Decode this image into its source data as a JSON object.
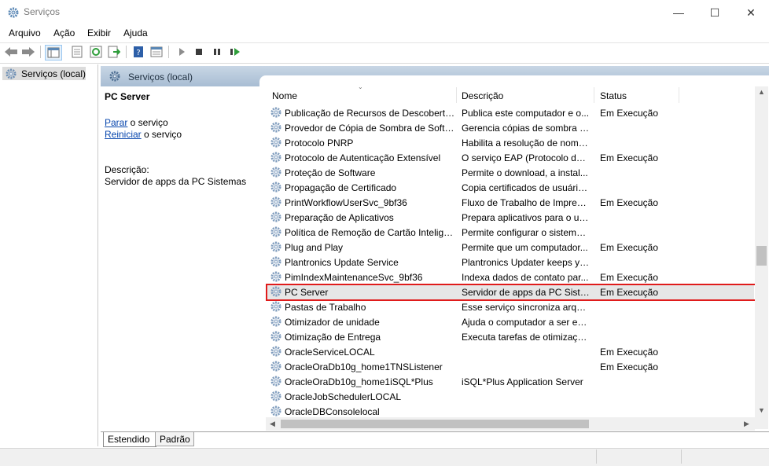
{
  "window": {
    "title": "Serviços",
    "controls": {
      "minimize": "—",
      "maximize": "☐",
      "close": "✕"
    }
  },
  "menu": [
    "Arquivo",
    "Ação",
    "Exibir",
    "Ajuda"
  ],
  "tree": {
    "root_label": "Serviços (local)"
  },
  "pane": {
    "header_title": "Serviços (local)",
    "selected_service_title": "PC Server",
    "links": {
      "stop": "Parar",
      "stop_suffix": " o serviço",
      "restart": "Reiniciar",
      "restart_suffix": " o serviço"
    },
    "description_label": "Descrição:",
    "description_text": "Servidor de apps da PC Sistemas"
  },
  "table": {
    "columns": [
      "Nome",
      "Descrição",
      "Status"
    ],
    "rows": [
      {
        "name": "Publicação de Recursos de Descoberta ...",
        "desc": "Publica este computador e o...",
        "status": "Em Execução"
      },
      {
        "name": "Provedor de Cópia de Sombra de Softw...",
        "desc": "Gerencia cópias de sombra d...",
        "status": ""
      },
      {
        "name": "Protocolo PNRP",
        "desc": "Habilita a resolução de nome...",
        "status": ""
      },
      {
        "name": "Protocolo de Autenticação Extensível",
        "desc": "O serviço EAP (Protocolo de ...",
        "status": "Em Execução"
      },
      {
        "name": "Proteção de Software",
        "desc": "Permite o download, a instal...",
        "status": ""
      },
      {
        "name": "Propagação de Certificado",
        "desc": "Copia certificados de usuário...",
        "status": ""
      },
      {
        "name": "PrintWorkflowUserSvc_9bf36",
        "desc": "Fluxo de Trabalho de Impress...",
        "status": "Em Execução"
      },
      {
        "name": "Preparação de Aplicativos",
        "desc": "Prepara aplicativos para o us...",
        "status": ""
      },
      {
        "name": "Política de Remoção de Cartão Intelige...",
        "desc": "Permite configurar o sistema ...",
        "status": ""
      },
      {
        "name": "Plug and Play",
        "desc": "Permite que um computador...",
        "status": "Em Execução"
      },
      {
        "name": "Plantronics Update Service",
        "desc": "Plantronics Updater keeps yo...",
        "status": ""
      },
      {
        "name": "PimIndexMaintenanceSvc_9bf36",
        "desc": "Indexa dados de contato par...",
        "status": "Em Execução"
      },
      {
        "name": "PC Server",
        "desc": "Servidor de apps da PC Siste...",
        "status": "Em Execução",
        "selected": true
      },
      {
        "name": "Pastas de Trabalho",
        "desc": "Esse serviço sincroniza arquiv...",
        "status": ""
      },
      {
        "name": "Otimizador de unidade",
        "desc": "Ajuda o computador a ser ex...",
        "status": ""
      },
      {
        "name": "Otimização de Entrega",
        "desc": "Executa tarefas de otimizaçã...",
        "status": ""
      },
      {
        "name": "OracleServiceLOCAL",
        "desc": "",
        "status": "Em Execução"
      },
      {
        "name": "OracleOraDb10g_home1TNSListener",
        "desc": "",
        "status": "Em Execução"
      },
      {
        "name": "OracleOraDb10g_home1iSQL*Plus",
        "desc": "iSQL*Plus Application Server",
        "status": ""
      },
      {
        "name": "OracleJobSchedulerLOCAL",
        "desc": "",
        "status": ""
      },
      {
        "name": "OracleDBConsolelocal",
        "desc": "",
        "status": ""
      }
    ]
  },
  "tabs": [
    "Estendido",
    "Padrão"
  ],
  "colors": {
    "highlight": "#e01b1b",
    "header_gradient_top": "#c8d6e5",
    "link": "#0645ad"
  },
  "icons": [
    "gear-icon",
    "back-arrow-icon",
    "forward-arrow-icon",
    "console-tree-icon",
    "properties-icon",
    "refresh-icon",
    "export-icon",
    "help-icon",
    "view-icon",
    "play-icon",
    "stop-icon",
    "pause-icon",
    "resume-icon"
  ]
}
